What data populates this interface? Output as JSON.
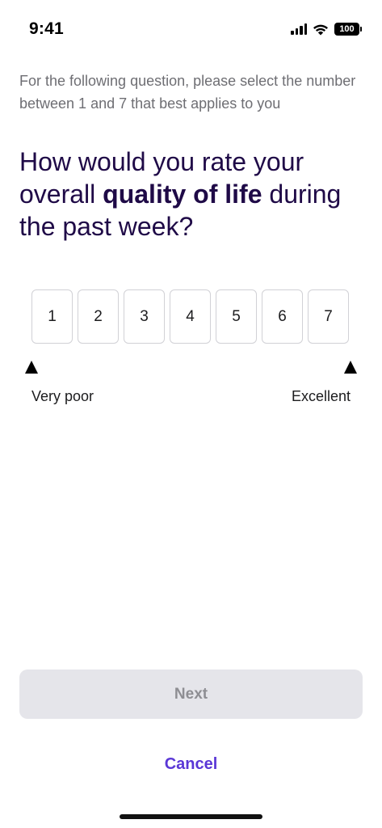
{
  "status_bar": {
    "time": "9:41",
    "battery": "100"
  },
  "instructions": "For the following question, please select the number between 1 and 7 that best applies to you",
  "question": {
    "prefix": "How would you rate your overall ",
    "emphasis": "quality of life",
    "suffix": " during the past week?"
  },
  "scale": {
    "options": [
      "1",
      "2",
      "3",
      "4",
      "5",
      "6",
      "7"
    ],
    "low_label": "Very poor",
    "high_label": "Excellent"
  },
  "actions": {
    "next_label": "Next",
    "cancel_label": "Cancel"
  },
  "colors": {
    "title": "#1f0a47",
    "accent": "#5a37d6",
    "disabled_bg": "#e5e5ea",
    "disabled_text": "#8e8e93"
  }
}
